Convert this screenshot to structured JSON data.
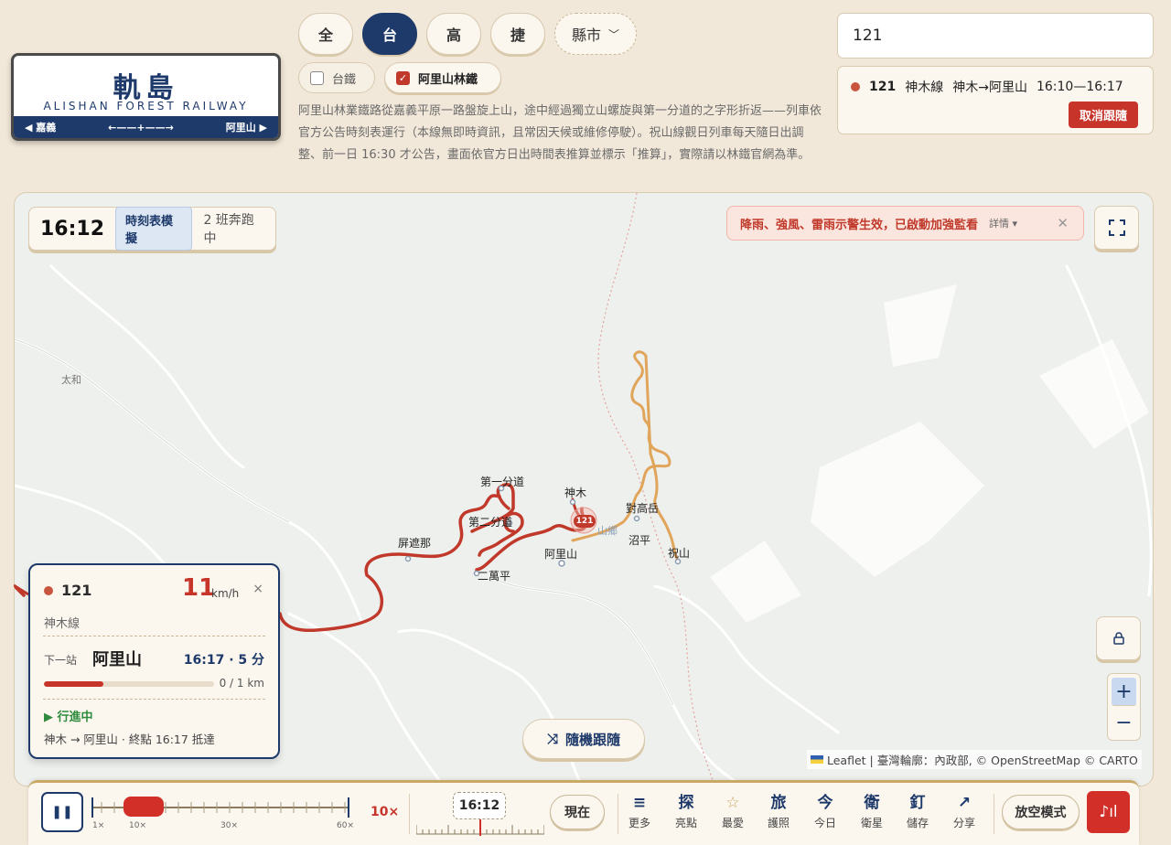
{
  "logo": {
    "title": "軌島",
    "subtitle": "ALISHAN FOREST RAILWAY",
    "left": "◀ 嘉義",
    "right": "阿里山 ▶"
  },
  "filters": {
    "all": "全",
    "tra": "台",
    "hsr": "高",
    "mrt": "捷",
    "county": "縣市"
  },
  "checks": {
    "tra_label": "台鐵",
    "tra_checked": false,
    "alishan_label": "阿里山林鐵",
    "alishan_checked": true
  },
  "description": "阿里山林業鐵路從嘉義平原一路盤旋上山，途中經過獨立山螺旋與第一分道的之字形折返——列車依官方公告時刻表運行（本線無即時資訊，且常因天候或維修停駛）。祝山線觀日列車每天隨日出調整、前一日 16:30 才公告，畫面依官方日出時間表推算並標示「推算」，實際請以林鐵官網為準。",
  "search": {
    "value": "121"
  },
  "tracked": {
    "train_no": "121",
    "line": "神木線",
    "route": "神木→阿里山",
    "time": "16:10—16:17",
    "cancel": "取消跟隨"
  },
  "clock": {
    "time": "16:12",
    "mode": "時刻表模擬",
    "running": "2 班奔跑中"
  },
  "alert": {
    "text": "降雨、強風、雷雨示警生效，已啟動加強監看",
    "details": "詳情 ▾",
    "close": "✕"
  },
  "map": {
    "labels": {
      "taihe": "太和",
      "first": "第一分道",
      "second": "第二分道",
      "pingzhena": "屏遮那",
      "erwanping": "二萬平",
      "shenmu": "神木",
      "alishan": "阿里山",
      "duigaoyue": "對高岳",
      "zhaoping": "沼平",
      "zhushan": "祝山",
      "mountain": "山鄉",
      "marker": "121"
    },
    "zoom_in": "+",
    "zoom_out": "−",
    "attribution": "Leaflet | 臺灣輪廓：內政部, © OpenStreetMap © CARTO",
    "random_follow": "隨機跟隨"
  },
  "card": {
    "train_no": "121",
    "speed": "11",
    "unit": "km/h",
    "close": "×",
    "line": "神木線",
    "next_label": "下一站",
    "next_station": "阿里山",
    "eta": "16:17 · 5 分",
    "progress": 0.35,
    "distance": "0 / 1 km",
    "status": "▶ 行進中",
    "route": "神木 → 阿里山 · 終點 16:17 抵達"
  },
  "bottom": {
    "speed_ticks": [
      "1×",
      "10×",
      "30×",
      "60×"
    ],
    "speed_value": "10×",
    "time_value": "16:12",
    "now": "現在",
    "tools": [
      {
        "icon": "≡",
        "label": "更多"
      },
      {
        "icon": "探",
        "label": "亮點"
      },
      {
        "icon": "☆",
        "label": "最愛"
      },
      {
        "icon": "旅",
        "label": "護照"
      },
      {
        "icon": "今",
        "label": "今日"
      },
      {
        "icon": "衛",
        "label": "衛星"
      },
      {
        "icon": "釘",
        "label": "儲存"
      },
      {
        "icon": "↗",
        "label": "分享"
      }
    ],
    "ambient": "放空模式"
  },
  "colors": {
    "primary": "#1e3a6b",
    "accent": "#c7342a",
    "route_main": "#c0392b",
    "route_zhushan": "#e0a55a",
    "background": "#f2e8d9"
  }
}
